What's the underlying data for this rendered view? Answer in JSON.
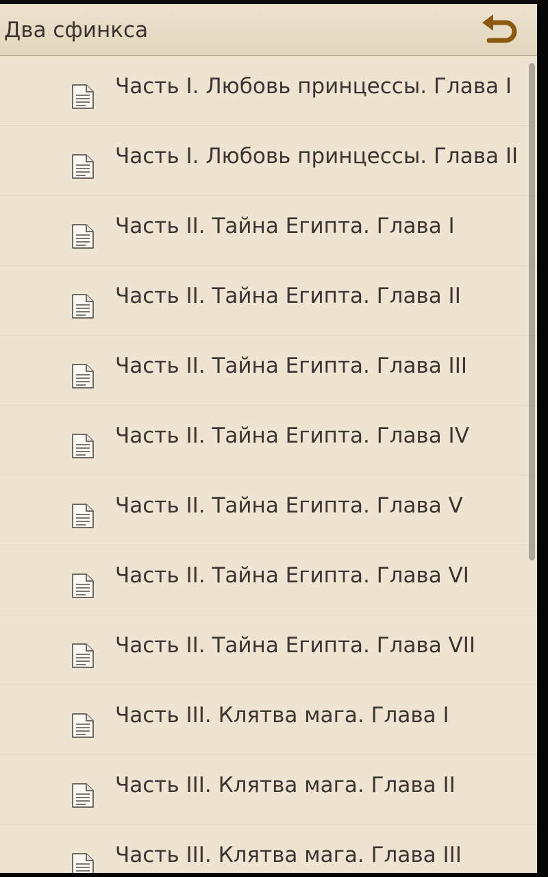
{
  "header": {
    "title": "Два сфинкса",
    "back_icon": "back-arrow-icon",
    "accent_color": "#8a5a10"
  },
  "chapters": [
    {
      "label": "Часть I. Любовь принцессы. Глава I",
      "icon": "document-icon"
    },
    {
      "label": "Часть I. Любовь принцессы. Глава II",
      "icon": "document-icon"
    },
    {
      "label": "Часть II. Тайна Египта. Глава I",
      "icon": "document-icon"
    },
    {
      "label": "Часть II. Тайна Египта. Глава II",
      "icon": "document-icon"
    },
    {
      "label": "Часть II. Тайна Египта. Глава III",
      "icon": "document-icon"
    },
    {
      "label": "Часть II. Тайна Египта. Глава IV",
      "icon": "document-icon"
    },
    {
      "label": "Часть II. Тайна Египта. Глава V",
      "icon": "document-icon"
    },
    {
      "label": "Часть II. Тайна Египта. Глава VI",
      "icon": "document-icon"
    },
    {
      "label": "Часть II. Тайна Египта. Глава VII",
      "icon": "document-icon"
    },
    {
      "label": "Часть III. Клятва мага. Глава I",
      "icon": "document-icon"
    },
    {
      "label": "Часть III. Клятва мага. Глава II",
      "icon": "document-icon"
    },
    {
      "label": "Часть III. Клятва мага. Глава III",
      "icon": "document-icon"
    }
  ]
}
